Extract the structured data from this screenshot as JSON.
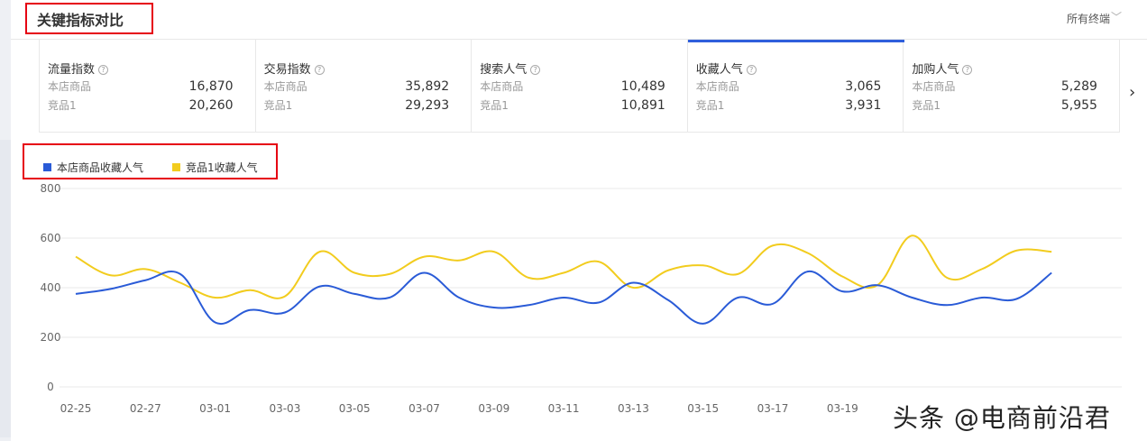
{
  "header": {
    "title": "关键指标对比",
    "terminal": "所有终端"
  },
  "cards": [
    {
      "name": "流量指数",
      "row1_label": "本店商品",
      "row1_value": "16,870",
      "row2_label": "竞品1",
      "row2_value": "20,260",
      "active": false
    },
    {
      "name": "交易指数",
      "row1_label": "本店商品",
      "row1_value": "35,892",
      "row2_label": "竞品1",
      "row2_value": "29,293",
      "active": false
    },
    {
      "name": "搜索人气",
      "row1_label": "本店商品",
      "row1_value": "10,489",
      "row2_label": "竞品1",
      "row2_value": "10,891",
      "active": false
    },
    {
      "name": "收藏人气",
      "row1_label": "本店商品",
      "row1_value": "3,065",
      "row2_label": "竞品1",
      "row2_value": "3,931",
      "active": true
    },
    {
      "name": "加购人气",
      "row1_label": "本店商品",
      "row1_value": "5,289",
      "row2_label": "竞品1",
      "row2_value": "5,955",
      "active": false
    }
  ],
  "colors": {
    "series_own": "#2a5bd7",
    "series_rival": "#f2cc1e",
    "highlight": "#e60012",
    "active_tab": "#2f5fdc"
  },
  "watermark": "头条 @电商前沿君",
  "chart_data": {
    "type": "line",
    "ylim": [
      0,
      800
    ],
    "yticks": [
      0,
      200,
      400,
      600,
      800
    ],
    "grid": true,
    "legend_position": "top-left",
    "x": [
      "02-25",
      "02-26",
      "02-27",
      "02-28",
      "03-01",
      "03-02",
      "03-03",
      "03-04",
      "03-05",
      "03-06",
      "03-07",
      "03-08",
      "03-09",
      "03-10",
      "03-11",
      "03-12",
      "03-13",
      "03-14",
      "03-15",
      "03-16",
      "03-17",
      "03-18",
      "03-19",
      "03-20",
      "03-21",
      "03-22",
      "03-23",
      "03-24",
      "03-25"
    ],
    "xtick_labels": [
      "02-25",
      "02-27",
      "03-01",
      "03-03",
      "03-05",
      "03-07",
      "03-09",
      "03-11",
      "03-13",
      "03-15",
      "03-17",
      "03-19"
    ],
    "series": [
      {
        "name": "本店商品收藏人气",
        "color": "#2a5bd7",
        "values": [
          375,
          395,
          430,
          455,
          260,
          310,
          300,
          405,
          375,
          360,
          460,
          360,
          320,
          330,
          360,
          340,
          420,
          350,
          255,
          360,
          335,
          465,
          385,
          410,
          360,
          330,
          360,
          355,
          460
        ]
      },
      {
        "name": "竞品1收藏人气",
        "color": "#f2cc1e",
        "values": [
          525,
          450,
          475,
          420,
          360,
          390,
          365,
          545,
          460,
          455,
          525,
          510,
          545,
          440,
          460,
          505,
          400,
          470,
          490,
          455,
          570,
          540,
          445,
          410,
          610,
          440,
          475,
          550,
          545
        ]
      }
    ]
  }
}
